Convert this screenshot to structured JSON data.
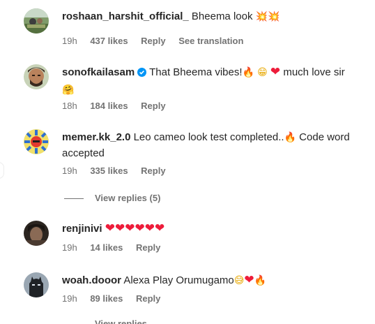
{
  "comments": [
    {
      "username": "roshaan_harshit_official_",
      "text": "Bheema look",
      "emojis": [
        "💥",
        "💥"
      ],
      "time": "19h",
      "likes": "437 likes",
      "reply": "Reply",
      "translate": "See translation"
    },
    {
      "username": "sonofkailasam",
      "verified": true,
      "text": "That Bheema vibes!",
      "emoji_after_vibes": [
        "🔥",
        "😁",
        "❤"
      ],
      "text2": "much love sir",
      "emoji_line2": "🤗",
      "time": "18h",
      "likes": "184 likes",
      "reply": "Reply"
    },
    {
      "username": "memer.kk_2.0",
      "text": "Leo cameo look test completed..",
      "emoji": "🔥",
      "text2": "Code word",
      "text3": "accepted",
      "time": "19h",
      "likes": "335 likes",
      "reply": "Reply"
    },
    {
      "username": "renjinivi",
      "emojis": [
        "❤",
        "❤",
        "❤",
        "❤",
        "❤",
        "❤"
      ],
      "time": "19h",
      "likes": "14 likes",
      "reply": "Reply"
    },
    {
      "username": "woah.dooor",
      "text": "Alexa Play Orumugamo",
      "emojis": [
        "😅",
        "❤",
        "🔥"
      ],
      "time": "19h",
      "likes": "89 likes",
      "reply": "Reply"
    }
  ],
  "view_replies": "View replies (5)",
  "partial_view_replies": "View replies",
  "colors": {
    "text": "#262626",
    "secondary": "#737373",
    "heart": "#ed1c3a",
    "verified": "#0095f6"
  }
}
